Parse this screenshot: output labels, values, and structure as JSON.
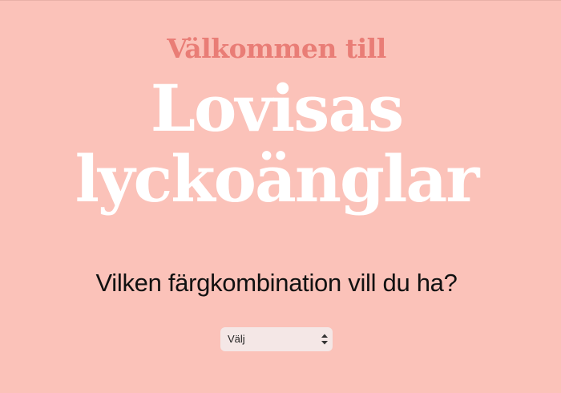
{
  "header": {
    "welcome": "Välkommen till",
    "title_line1": "Lovisas",
    "title_line2": "lyckoänglar"
  },
  "main": {
    "question": "Vilken färgkombination vill du ha?",
    "color_select": {
      "selected": "Välj",
      "icon": "select-arrows-icon"
    }
  },
  "colors": {
    "background": "#fbc2b9",
    "welcome_text": "#e97d76",
    "title_text": "#ffffff",
    "question_text": "#111111",
    "select_background": "#f4e7e6"
  }
}
